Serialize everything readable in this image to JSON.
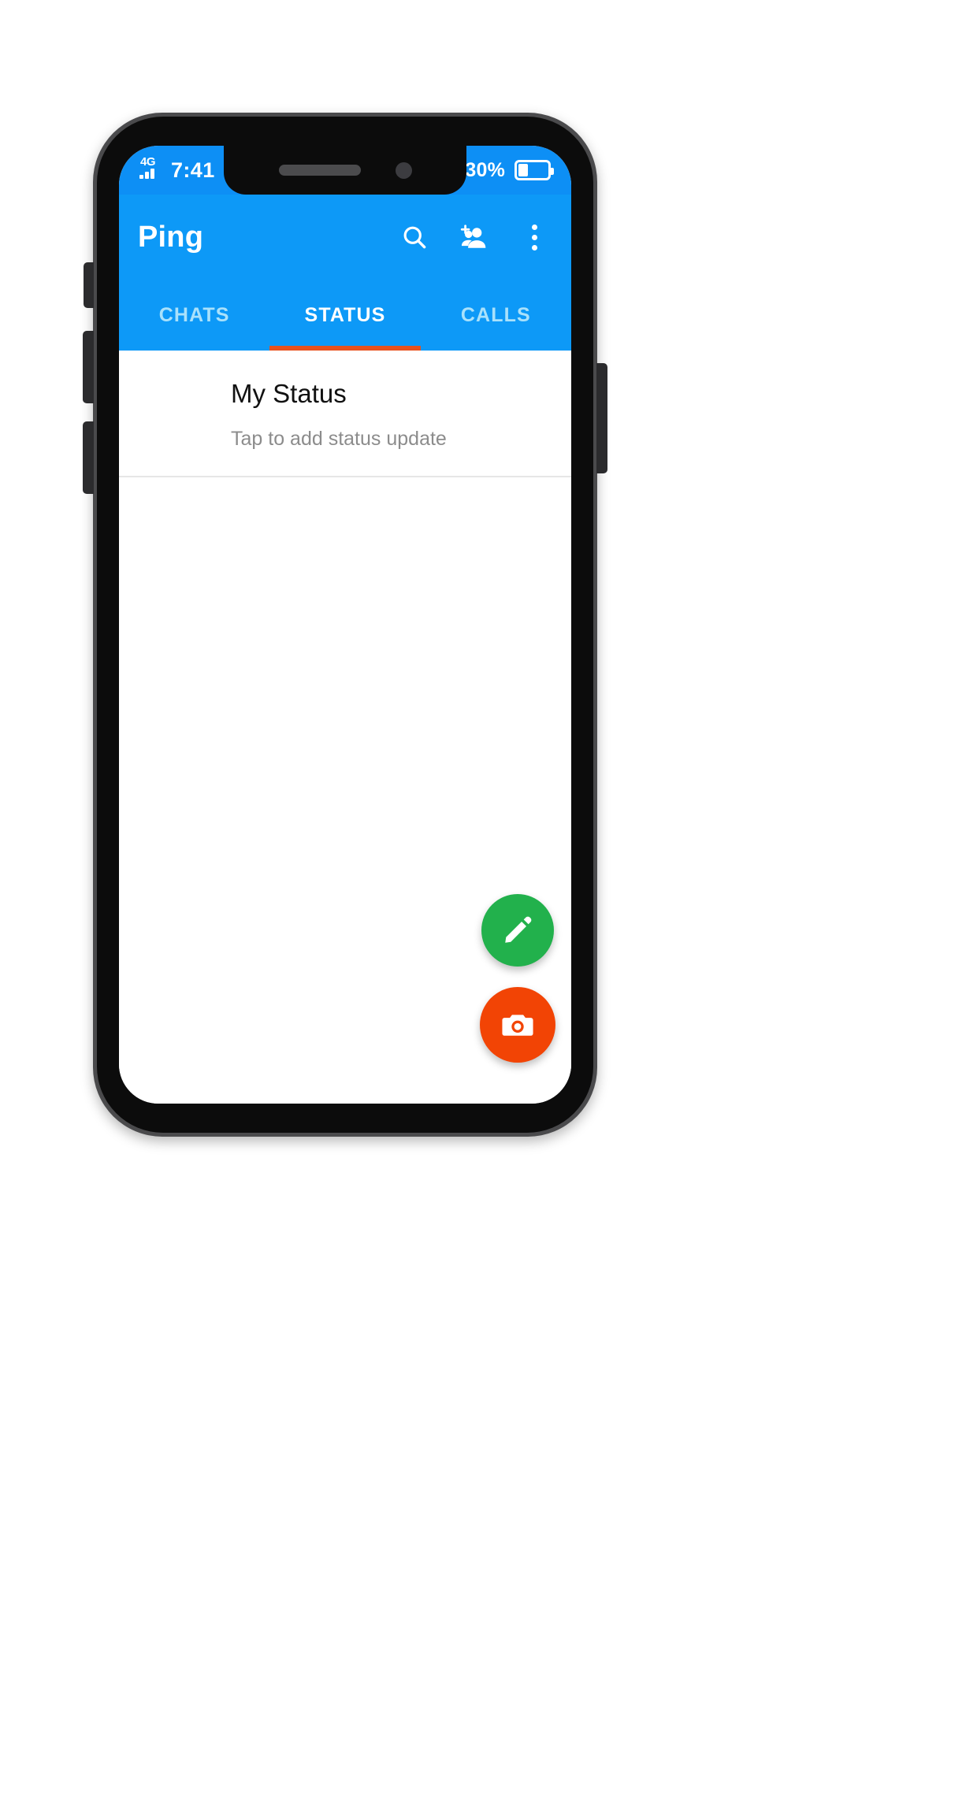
{
  "statusbar": {
    "network_label": "4G",
    "signal_icon": "signal-bars-icon",
    "time": "7:41",
    "wifi_icon": "wifi-icon",
    "battery_percent": "30%",
    "battery_icon": "battery-low-icon",
    "battery_level": 30
  },
  "appbar": {
    "title": "Ping",
    "search_icon": "search-icon",
    "add_contact_icon": "person-add-icon",
    "overflow_icon": "more-vertical-icon",
    "background_color": "#0d99f7"
  },
  "tabs": {
    "items": [
      {
        "label": "CHATS",
        "active": false
      },
      {
        "label": "STATUS",
        "active": true
      },
      {
        "label": "CALLS",
        "active": false
      }
    ],
    "indicator_color": "#e8511c",
    "active_color": "#ffffff",
    "inactive_color": "#a9e1fb"
  },
  "status_list": {
    "my_status": {
      "title": "My Status",
      "subtitle": "Tap to add status update"
    }
  },
  "fabs": {
    "edit": {
      "icon": "pencil-icon",
      "color": "#22b14c"
    },
    "camera": {
      "icon": "camera-icon",
      "color": "#f24405"
    }
  }
}
